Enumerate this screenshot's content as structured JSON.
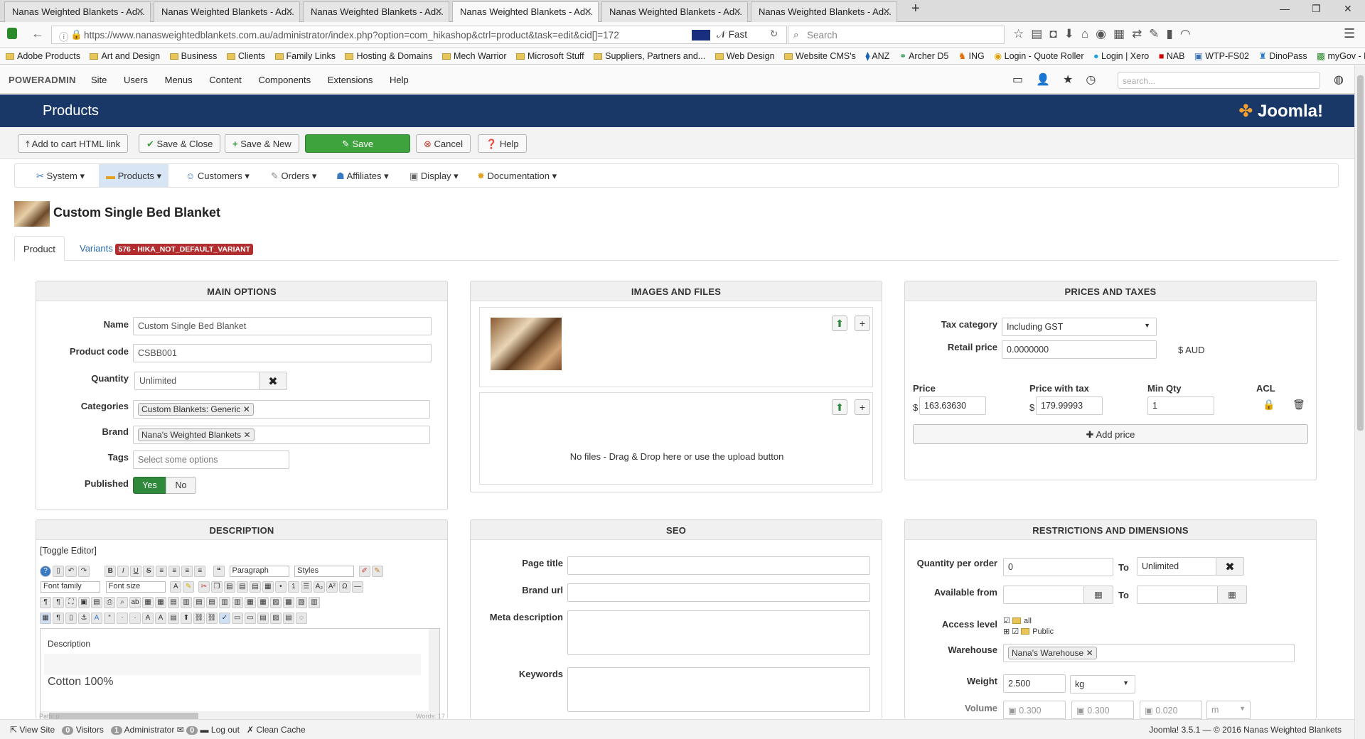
{
  "browser": {
    "tabs": [
      {
        "label": "Nanas Weighted Blankets - Ad..."
      },
      {
        "label": "Nanas Weighted Blankets - Ad..."
      },
      {
        "label": "Nanas Weighted Blankets - Ad..."
      },
      {
        "label": "Nanas Weighted Blankets - Ad..."
      },
      {
        "label": "Nanas Weighted Blankets - Ad..."
      },
      {
        "label": "Nanas Weighted Blankets - Ad..."
      }
    ],
    "url": "https://www.nanasweightedblankets.com.au/administrator/index.php?option=com_hikashop&ctrl=product&task=edit&cid[]=172",
    "speed_label": "Fast",
    "search_placeholder": "Search",
    "bookmarks": [
      "Adobe Products",
      "Art and Design",
      "Business",
      "Clients",
      "Family Links",
      "Hosting & Domains",
      "Mech Warrior",
      "Microsoft Stuff",
      "Suppliers, Partners and...",
      "Web Design",
      "Website CMS's",
      "ANZ",
      "Archer D5",
      "ING",
      "Login - Quote Roller",
      "Login | Xero",
      "NAB",
      "WTP-FS02",
      "DinoPass",
      "myGov - Home"
    ]
  },
  "admin": {
    "brand": "POWERADMIN",
    "menu": [
      "Site",
      "Users",
      "Menus",
      "Content",
      "Components",
      "Extensions",
      "Help"
    ],
    "search_placeholder": "search...",
    "page_title": "Products",
    "logo_text": "Joomla!"
  },
  "toolbar": {
    "add_to_cart": "Add to cart HTML link",
    "save_close": "Save & Close",
    "save_new": "Save & New",
    "save": "Save",
    "cancel": "Cancel",
    "help": "Help"
  },
  "hikamenu": [
    "System",
    "Products",
    "Customers",
    "Orders",
    "Affiliates",
    "Display",
    "Documentation"
  ],
  "product": {
    "title": "Custom Single Bed Blanket",
    "tab_product": "Product",
    "tab_variants": "Variants",
    "variants_badge": "576 - HIKA_NOT_DEFAULT_VARIANT"
  },
  "main_options": {
    "heading": "MAIN OPTIONS",
    "name_label": "Name",
    "name_value": "Custom Single Bed Blanket",
    "code_label": "Product code",
    "code_value": "CSBB001",
    "quantity_label": "Quantity",
    "quantity_value": "Unlimited",
    "categories_label": "Categories",
    "categories_value": "Custom Blankets: Generic",
    "brand_label": "Brand",
    "brand_value": "Nana's Weighted Blankets",
    "tags_label": "Tags",
    "tags_placeholder": "Select some options",
    "published_label": "Published",
    "yes": "Yes",
    "no": "No"
  },
  "images": {
    "heading": "IMAGES AND FILES",
    "no_files": "No files - Drag & Drop here or use the upload button"
  },
  "prices": {
    "heading": "PRICES AND TAXES",
    "tax_label": "Tax category",
    "tax_value": "Including GST",
    "retail_label": "Retail price",
    "retail_value": "0.0000000",
    "currency": "$ AUD",
    "col_price": "Price",
    "col_price_tax": "Price with tax",
    "col_min_qty": "Min Qty",
    "col_acl": "ACL",
    "dollar": "$",
    "price_value": "163.63630",
    "price_tax_value": "179.99993",
    "min_qty_value": "1",
    "add_price": "Add price"
  },
  "description": {
    "heading": "DESCRIPTION",
    "toggle": "[Toggle Editor]",
    "paragraph": "Paragraph",
    "styles": "Styles",
    "font_family": "Font family",
    "font_size": "Font size",
    "content_heading": "Description",
    "content_text": "Cotton 100%",
    "path": "Path: p",
    "words": "Words: 17"
  },
  "seo": {
    "heading": "SEO",
    "page_title": "Page title",
    "brand_url": "Brand url",
    "meta_description": "Meta description",
    "keywords": "Keywords"
  },
  "restrictions": {
    "heading": "RESTRICTIONS AND DIMENSIONS",
    "qty_per_order": "Quantity per order",
    "qty_from": "0",
    "to": "To",
    "qty_to": "Unlimited",
    "available_from": "Available from",
    "access_level": "Access level",
    "access_all": "all",
    "access_public": "Public",
    "warehouse_label": "Warehouse",
    "warehouse_value": "Nana's Warehouse",
    "weight_label": "Weight",
    "weight_value": "2.500",
    "weight_unit": "kg",
    "volume_label": "Volume",
    "vol_1": "0.300",
    "vol_2": "0.300",
    "vol_3": "0.020",
    "vol_unit": "m"
  },
  "statusbar": {
    "view_site": "View Site",
    "visitors_count": "0",
    "visitors": "Visitors",
    "admin_count": "1",
    "administrator": "Administrator",
    "messages_count": "0",
    "logout": "Log out",
    "clean_cache": "Clean Cache",
    "copyright": "Joomla! 3.5.1 — © 2016 Nanas Weighted Blankets"
  }
}
